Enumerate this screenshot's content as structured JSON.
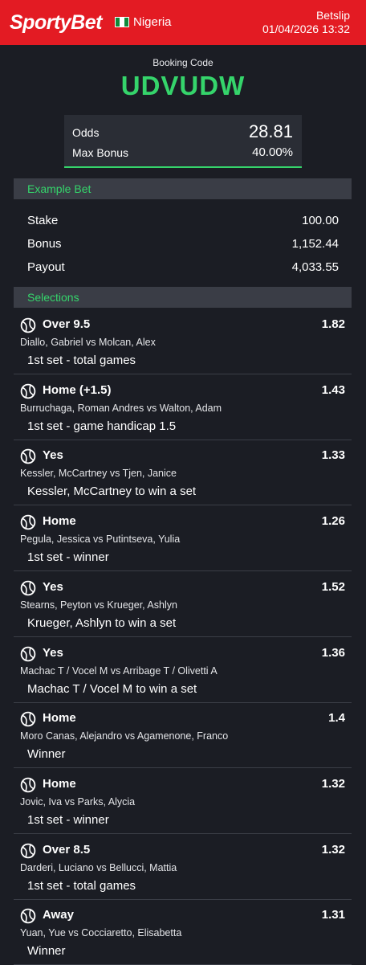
{
  "header": {
    "logo": "SportyBet",
    "country": "Nigeria",
    "title": "Betslip",
    "datetime": "01/04/2026 13:32",
    "colors": {
      "brand": "#e31b23",
      "accent": "#35d46b"
    }
  },
  "booking": {
    "label": "Booking Code",
    "code": "UDVUDW"
  },
  "odds": {
    "odds_label": "Odds",
    "odds_value": "28.81",
    "bonus_label": "Max Bonus",
    "bonus_value": "40.00%"
  },
  "example_bet": {
    "title": "Example Bet",
    "rows": [
      {
        "label": "Stake",
        "value": "100.00"
      },
      {
        "label": "Bonus",
        "value": "1,152.44"
      },
      {
        "label": "Payout",
        "value": "4,033.55"
      }
    ]
  },
  "selections": {
    "title": "Selections",
    "icon": "tennis-ball-icon",
    "items": [
      {
        "pick": "Over 9.5",
        "odd": "1.82",
        "event": "Diallo, Gabriel vs Molcan, Alex",
        "market": "1st set - total games"
      },
      {
        "pick": "Home (+1.5)",
        "odd": "1.43",
        "event": "Burruchaga, Roman Andres vs Walton, Adam",
        "market": "1st set - game handicap 1.5"
      },
      {
        "pick": "Yes",
        "odd": "1.33",
        "event": "Kessler, McCartney vs Tjen, Janice",
        "market": "Kessler, McCartney to win a set"
      },
      {
        "pick": "Home",
        "odd": "1.26",
        "event": "Pegula, Jessica vs Putintseva, Yulia",
        "market": "1st set - winner"
      },
      {
        "pick": "Yes",
        "odd": "1.52",
        "event": "Stearns, Peyton vs Krueger, Ashlyn",
        "market": "Krueger, Ashlyn to win a set"
      },
      {
        "pick": "Yes",
        "odd": "1.36",
        "event": "Machac T / Vocel M vs Arribage T / Olivetti A",
        "market": "Machac T / Vocel M to win a set"
      },
      {
        "pick": "Home",
        "odd": "1.4",
        "event": "Moro Canas, Alejandro vs Agamenone, Franco",
        "market": "Winner"
      },
      {
        "pick": "Home",
        "odd": "1.32",
        "event": "Jovic, Iva vs Parks, Alycia",
        "market": "1st set - winner"
      },
      {
        "pick": "Over 8.5",
        "odd": "1.32",
        "event": "Darderi, Luciano vs Bellucci, Mattia",
        "market": "1st set - total games"
      },
      {
        "pick": "Away",
        "odd": "1.31",
        "event": "Yuan, Yue vs Cocciaretto, Elisabetta",
        "market": "Winner"
      }
    ]
  }
}
